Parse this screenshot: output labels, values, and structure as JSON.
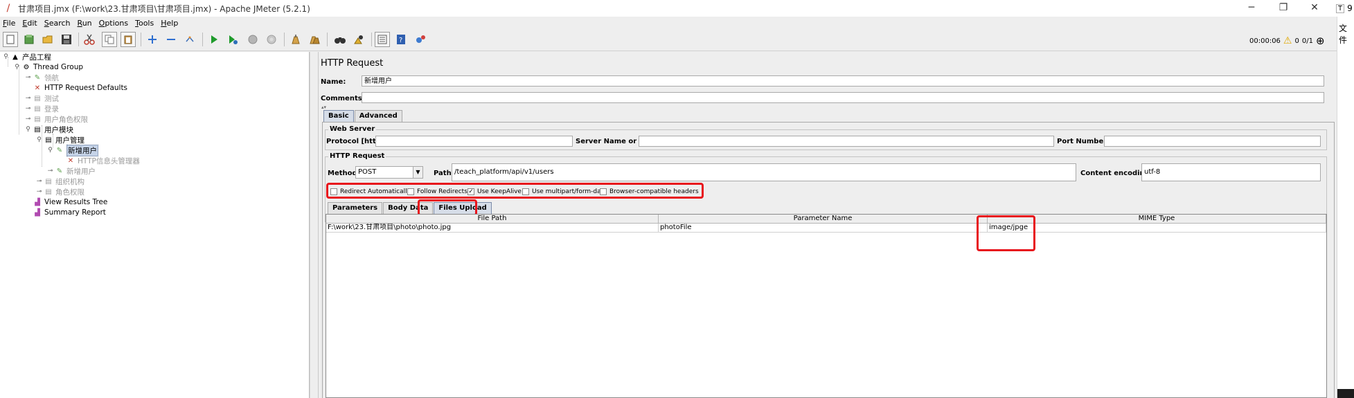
{
  "window": {
    "title": "甘肃项目.jmx (F:\\work\\23.甘肃项目\\甘肃项目.jmx) - Apache JMeter (5.2.1)",
    "minimize": "─",
    "restore": "❐",
    "close": "✕"
  },
  "menu": {
    "items": [
      {
        "first": "F",
        "rest": "ile"
      },
      {
        "first": "E",
        "rest": "dit"
      },
      {
        "first": "S",
        "rest": "earch"
      },
      {
        "first": "R",
        "rest": "un"
      },
      {
        "first": "O",
        "rest": "ptions"
      },
      {
        "first": "T",
        "rest": "ools"
      },
      {
        "first": "H",
        "rest": "elp"
      }
    ]
  },
  "toolbar": {
    "timer": "00:00:06",
    "warnings": "0",
    "threads": "0/1"
  },
  "tree": {
    "nodes": [
      {
        "label": "产品工程"
      },
      {
        "label": "Thread Group"
      },
      {
        "label": "领航"
      },
      {
        "label": "HTTP Request Defaults"
      },
      {
        "label": "测试"
      },
      {
        "label": "登录"
      },
      {
        "label": "用户角色权限"
      },
      {
        "label": "用户模块"
      },
      {
        "label": "用户管理"
      },
      {
        "label": "新增用户"
      },
      {
        "label": "HTTP信息头管理器"
      },
      {
        "label": "新增用户"
      },
      {
        "label": "组织机构"
      },
      {
        "label": "角色权限"
      },
      {
        "label": "View Results Tree"
      },
      {
        "label": "Summary Report"
      }
    ]
  },
  "sampler": {
    "title": "HTTP Request",
    "name_label": "Name:",
    "name_value": "新增用户",
    "comments_label": "Comments:",
    "comments_value": "",
    "tabs": [
      "Basic",
      "Advanced"
    ],
    "web_server": {
      "title": "Web Server",
      "protocol_label": "Protocol [http]:",
      "protocol_value": "",
      "server_label": "Server Name or IP:",
      "server_value": "",
      "port_label": "Port Number:",
      "port_value": ""
    },
    "http_request": {
      "title": "HTTP Request",
      "method_label": "Method:",
      "method_value": "POST",
      "path_label": "Path:",
      "path_value": "/teach_platform/api/v1/users",
      "encoding_label": "Content encoding:",
      "encoding_value": "utf-8"
    },
    "options": [
      {
        "label": "Redirect Automatically",
        "checked": false
      },
      {
        "label": "Follow Redirects",
        "checked": false
      },
      {
        "label": "Use KeepAlive",
        "checked": true
      },
      {
        "label": "Use multipart/form-data",
        "checked": false
      },
      {
        "label": "Browser-compatible headers",
        "checked": false
      }
    ],
    "subtabs": [
      "Parameters",
      "Body Data",
      "Files Upload"
    ],
    "files_table": {
      "headers": [
        "File Path",
        "Parameter Name",
        "MIME Type"
      ],
      "rows": [
        [
          "F:\\work\\23.甘肃项目\\photo\\photo.jpg",
          "photoFile",
          "image/jpge"
        ]
      ]
    }
  },
  "edge": {
    "letter": "T",
    "digit": "9",
    "text": "文件"
  },
  "colors": {
    "highlight": "#e8141c",
    "selection": "#c5d3e8"
  }
}
